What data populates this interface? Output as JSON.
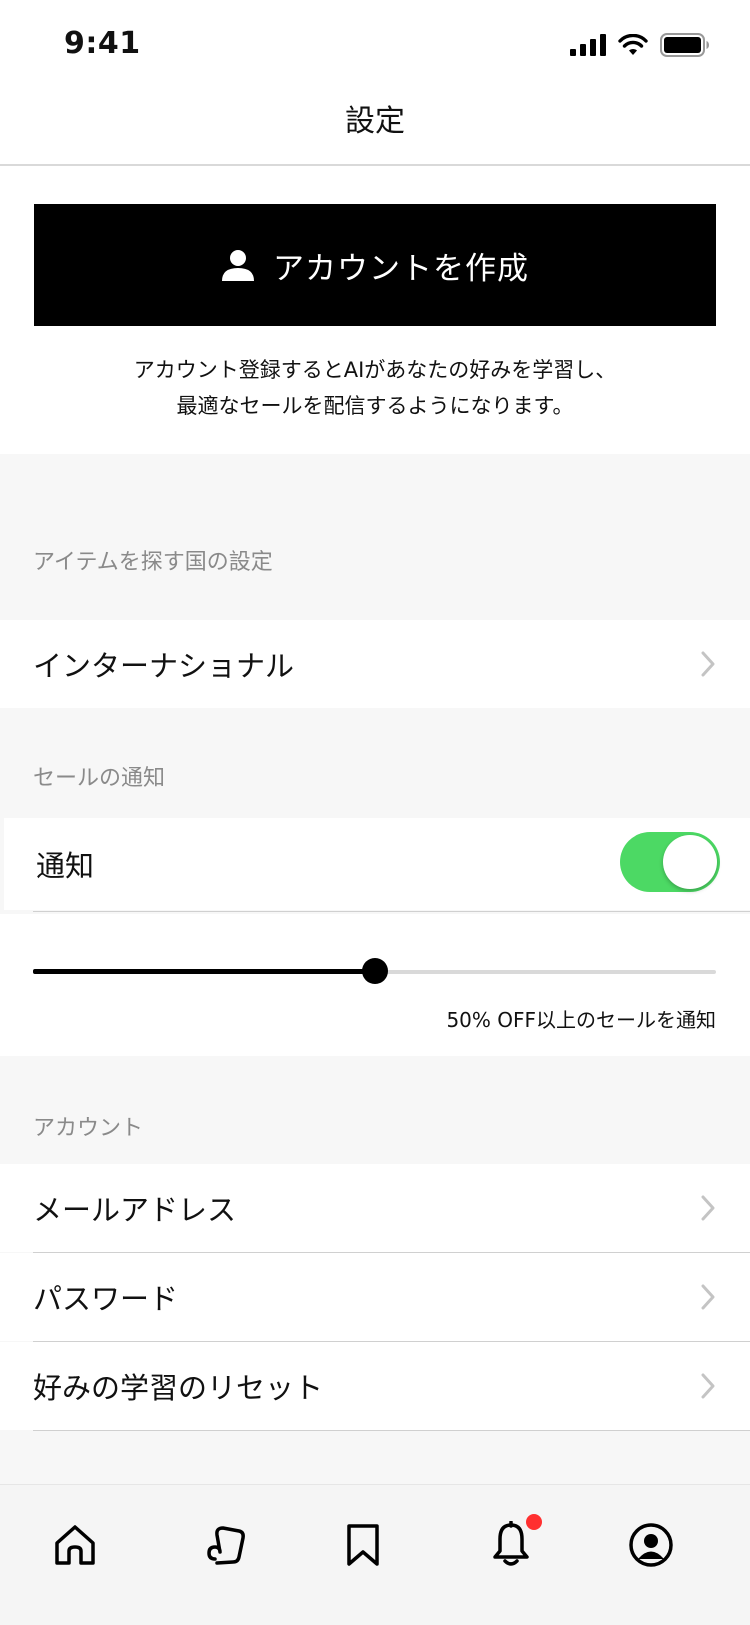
{
  "status_bar": {
    "time": "9:41"
  },
  "nav": {
    "title": "設定"
  },
  "account_card": {
    "button_label": "アカウントを作成",
    "promo_line1": "アカウント登録するとAIがあなたの好みを学習し、",
    "promo_line2": "最適なセールを配信するようになります。"
  },
  "country_section": {
    "header": "アイテムを探す国の設定",
    "value": "インターナショナル"
  },
  "notification_section": {
    "header": "セールの通知",
    "toggle_label": "通知",
    "toggle_on": true,
    "slider_percent": 50,
    "slider_caption": "50% OFF以上のセールを通知"
  },
  "account_section": {
    "header": "アカウント",
    "items": [
      {
        "label": "メールアドレス"
      },
      {
        "label": "パスワード"
      },
      {
        "label": "好みの学習のリセット"
      }
    ]
  },
  "tab_bar": {
    "tabs": [
      {
        "icon": "home-icon"
      },
      {
        "icon": "discover-icon"
      },
      {
        "icon": "bookmark-icon"
      },
      {
        "icon": "bell-icon",
        "badge": true
      },
      {
        "icon": "profile-icon",
        "active": true
      }
    ]
  },
  "colors": {
    "toggle_on": "#4cd964",
    "badge": "#ff3030",
    "primary_button": "#000000"
  }
}
